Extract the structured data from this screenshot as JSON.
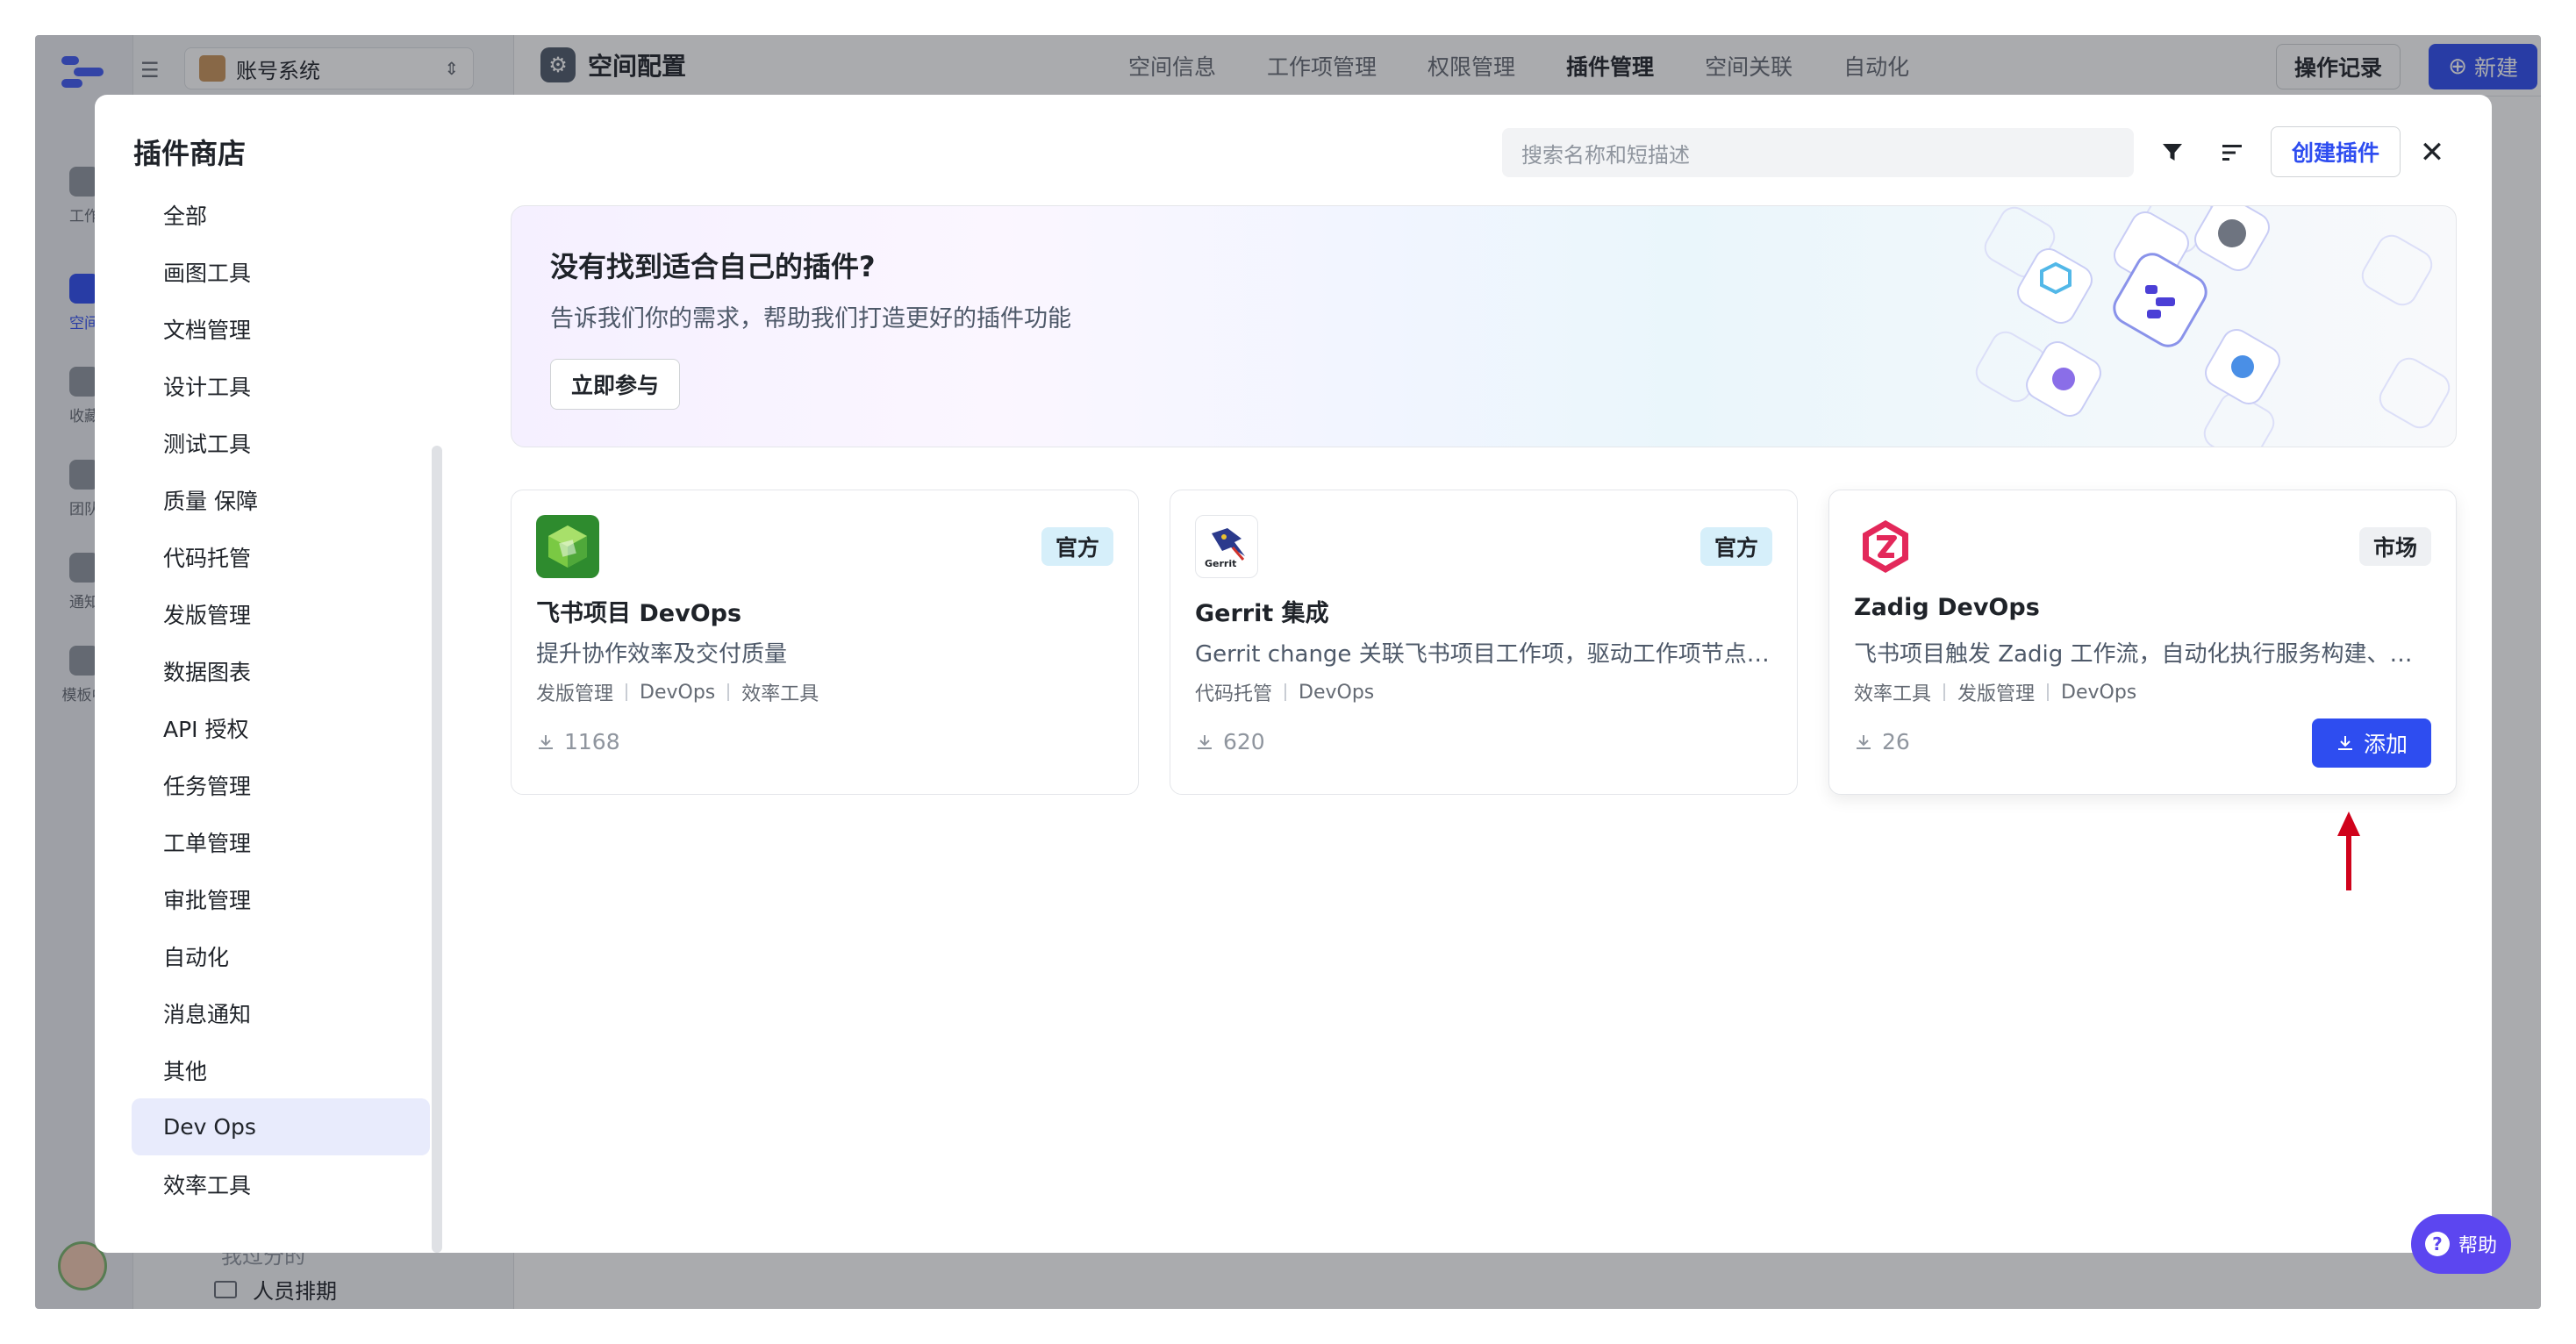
{
  "app": {
    "project_name": "账号系统",
    "space_title": "空间配置",
    "top_tabs": [
      "空间信息",
      "工作项管理",
      "权限管理",
      "插件管理",
      "空间关联",
      "自动化"
    ],
    "active_tab": "插件管理",
    "log_button": "操作记录",
    "new_button": "新建",
    "rail_labels": [
      "工作",
      "空间",
      "收藏",
      "团队",
      "通知",
      "模板中"
    ],
    "sidebar_tail": [
      "我过分的",
      "人员排期"
    ]
  },
  "modal": {
    "title": "插件商店",
    "search_placeholder": "搜索名称和短描述",
    "create_button": "创建插件",
    "close_glyph": "✕",
    "categories": [
      "全部",
      "画图工具",
      "文档管理",
      "设计工具",
      "测试工具",
      "质量 保障",
      "代码托管",
      "发版管理",
      "数据图表",
      "API 授权",
      "任务管理",
      "工单管理",
      "审批管理",
      "自动化",
      "消息通知",
      "其他",
      "Dev Ops",
      "效率工具"
    ],
    "active_category": "Dev Ops"
  },
  "banner": {
    "title": "没有找到适合自己的插件?",
    "subtitle": "告诉我们你的需求，帮助我们打造更好的插件功能",
    "button": "立即参与"
  },
  "plugins": [
    {
      "name": "飞书项目 DevOps",
      "badge": "官方",
      "description": "提升协作效率及交付质量",
      "tags": [
        "发版管理",
        "DevOps",
        "效率工具"
      ],
      "downloads": "1168",
      "logo": "green-cube-icon"
    },
    {
      "name": "Gerrit 集成",
      "badge": "官方",
      "description": "Gerrit change 关联飞书项目工作项，驱动工作项节点流...",
      "tags": [
        "代码托管",
        "DevOps"
      ],
      "downloads": "620",
      "logo": "gerrit-icon",
      "logo_text": "Gerrit"
    },
    {
      "name": "Zadig DevOps",
      "badge": "市场",
      "description": "飞书项目触发 Zadig 工作流，自动化执行服务构建、部...",
      "tags": [
        "效率工具",
        "发版管理",
        "DevOps"
      ],
      "downloads": "26",
      "logo": "zadig-icon",
      "add_button": "添加"
    }
  ],
  "help_button": "帮助",
  "colors": {
    "accent": "#2e4df0",
    "badge_bg": "#d6effa",
    "annotation_arrow": "#d0021b",
    "help_bg": "#5c46f0"
  }
}
